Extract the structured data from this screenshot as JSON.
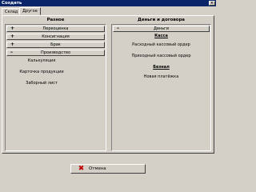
{
  "window": {
    "title": "Создать",
    "close_glyph": "×"
  },
  "tabs": [
    {
      "label": "Склад",
      "active": false
    },
    {
      "label": "Другое",
      "active": true
    }
  ],
  "left": {
    "title": "Разное",
    "groups": [
      {
        "sign": "+",
        "label": "Переоценка"
      },
      {
        "sign": "+",
        "label": "Консигнация"
      },
      {
        "sign": "+",
        "label": "Брак"
      },
      {
        "sign": "–",
        "label": "Производство"
      }
    ],
    "items": [
      "Калькуляция",
      "Карточка продукции",
      "Заборный лист"
    ]
  },
  "right": {
    "title": "Деньги и договора",
    "group": {
      "sign": "–",
      "label": "Деньги"
    },
    "sections": [
      {
        "title": "Касса",
        "items": [
          "Расходный кассовый ордер",
          "Приходный кассовый ордер"
        ]
      },
      {
        "title": "Безнал",
        "items": [
          "Новая платёжка"
        ]
      }
    ]
  },
  "footer": {
    "cancel_label": "Отмена",
    "cancel_icon": "x-icon",
    "cancel_glyph": "✖",
    "icon_color": "#c00000"
  }
}
